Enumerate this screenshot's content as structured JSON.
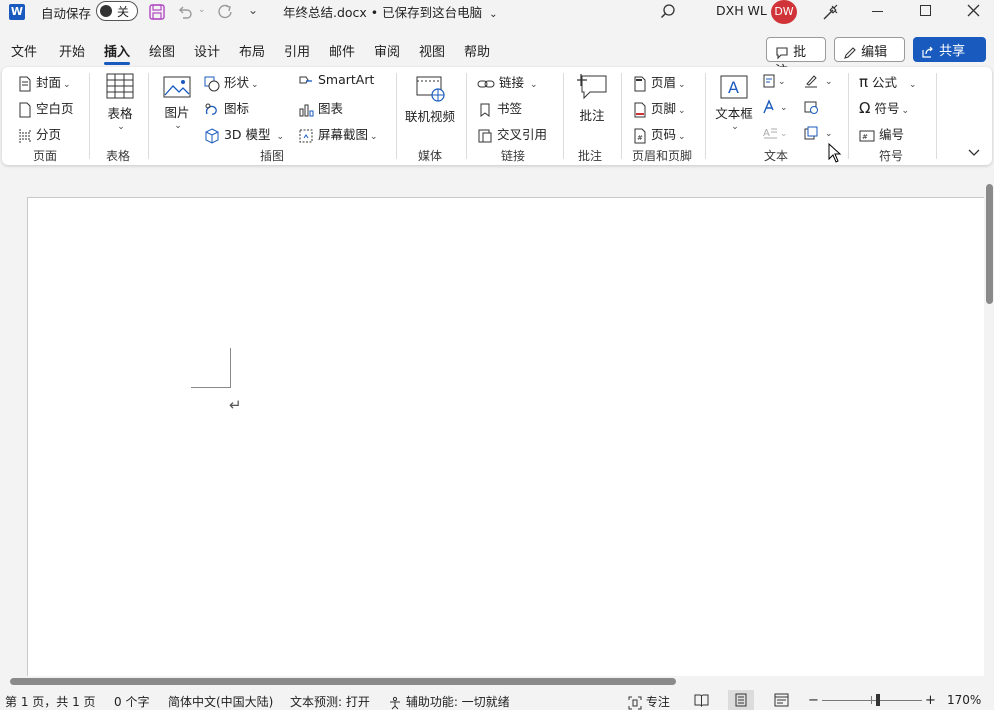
{
  "titlebar": {
    "autosave_label": "自动保存",
    "autosave_state": "关",
    "doc_title": "年终总结.docx • 已保存到这台电脑",
    "user_name": "DXH WL",
    "avatar_initials": "DW"
  },
  "menu": {
    "tabs": [
      "文件",
      "开始",
      "插入",
      "绘图",
      "设计",
      "布局",
      "引用",
      "邮件",
      "审阅",
      "视图",
      "帮助"
    ],
    "active": "插入",
    "comments_button": "批注",
    "edit_button": "编辑",
    "share_button": "共享"
  },
  "ribbon": {
    "pages": {
      "cover": "封面",
      "blank": "空白页",
      "break": "分页",
      "group": "页面"
    },
    "tables": {
      "table": "表格",
      "group": "表格"
    },
    "illustrations": {
      "pictures": "图片",
      "shapes": "形状",
      "icons": "图标",
      "models": "3D 模型",
      "smartart": "SmartArt",
      "chart": "图表",
      "screenshot": "屏幕截图",
      "group": "插图"
    },
    "media": {
      "online_video": "联机视频",
      "group": "媒体"
    },
    "links": {
      "link": "链接",
      "bookmark": "书签",
      "crossref": "交叉引用",
      "group": "链接"
    },
    "comments": {
      "comment": "批注",
      "group": "批注"
    },
    "header_footer": {
      "header": "页眉",
      "footer": "页脚",
      "page_number": "页码",
      "group": "页眉和页脚"
    },
    "text": {
      "textbox": "文本框",
      "group": "文本"
    },
    "symbols": {
      "equation": "公式",
      "symbol": "符号",
      "number": "编号",
      "group": "符号"
    }
  },
  "status": {
    "page": "第 1 页，共 1 页",
    "words": "0 个字",
    "language": "简体中文(中国大陆)",
    "text_prediction": "文本预测: 打开",
    "accessibility": "辅助功能: 一切就绪",
    "focus": "专注",
    "zoom": "170%"
  },
  "colors": {
    "accent": "#185abd",
    "avatar": "#d13438",
    "word_icon": "#185abd"
  }
}
